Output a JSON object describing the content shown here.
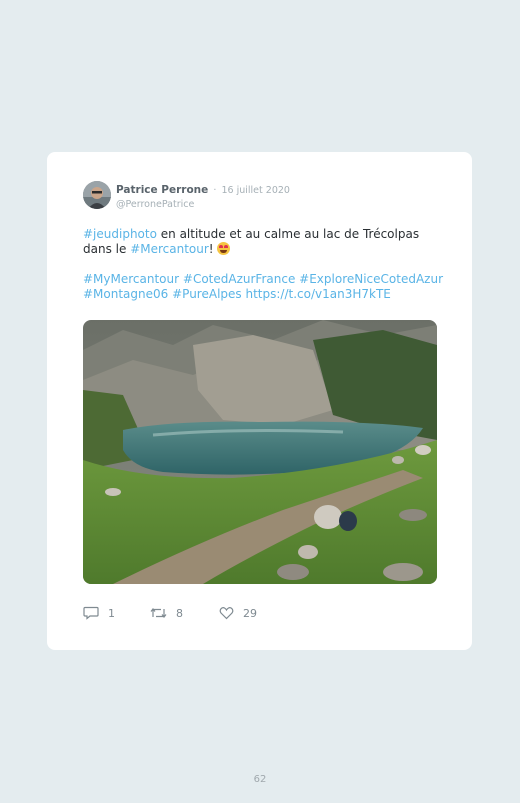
{
  "tweet": {
    "author_name": "Patrice Perrone",
    "separator": "·",
    "date": "16 juillet 2020",
    "handle": "@PerronePatrice",
    "line1_tag": "#jeudiphoto",
    "line1_text": " en altitude et au calme au lac de Trécolpas",
    "line2_text": "dans le ",
    "line2_tag": "#Mercantour",
    "line2_after": "! ",
    "tags_row1": [
      "#MyMercantour",
      "#CotedAzurFrance",
      "#ExploreNiceCotedAzur"
    ],
    "tags_row2": [
      "#Montagne06",
      "#PureAlpes"
    ],
    "link": "https://t.co/v1an3H7kTE",
    "replies": "1",
    "retweets": "8",
    "likes": "29"
  },
  "icons": {
    "avatar": "profile-photo",
    "emoji": "heart-eyes-emoji",
    "reply": "reply-icon",
    "retweet": "retweet-icon",
    "like": "heart-icon"
  },
  "colors": {
    "accent": "#5ab4e6",
    "background": "#e4ecef",
    "card": "#ffffff",
    "muted": "#a6b0b6"
  },
  "page_number": "62"
}
